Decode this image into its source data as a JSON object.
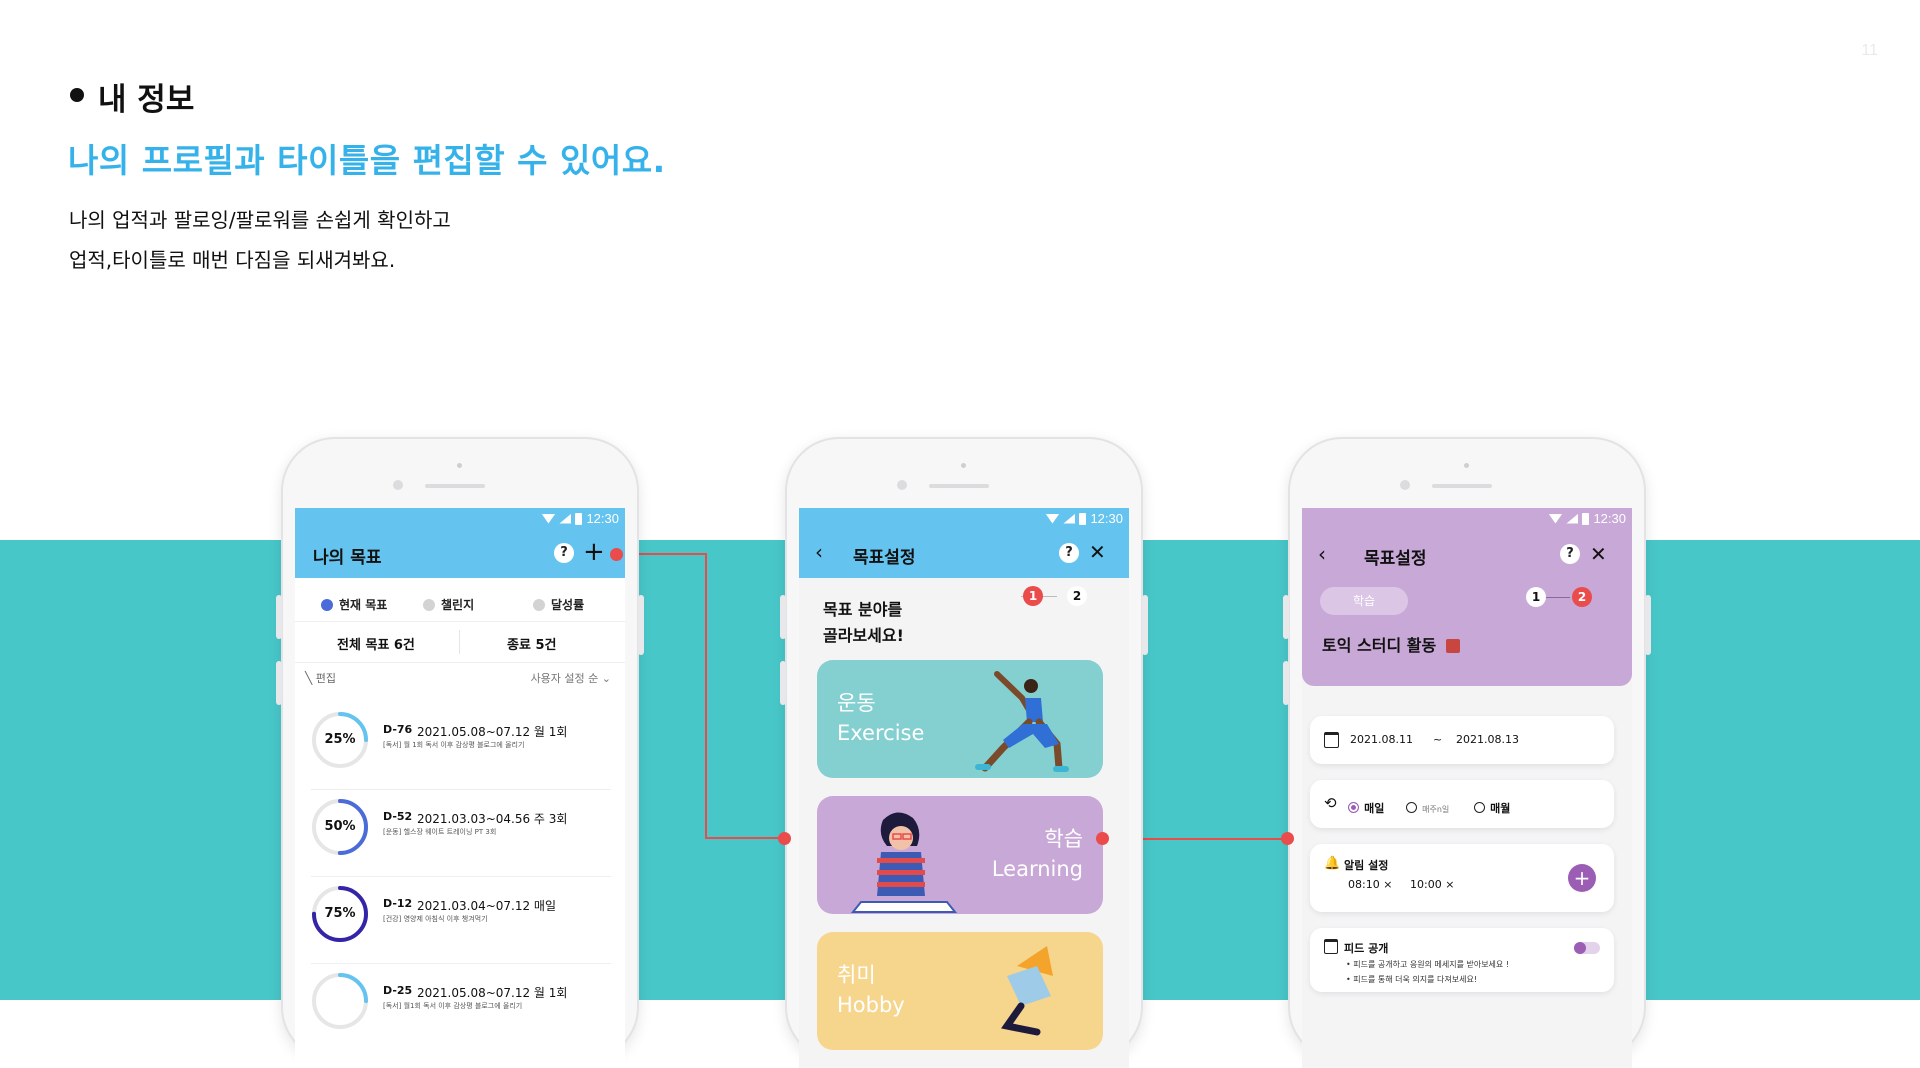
{
  "page": {
    "page_number": "11",
    "section_title": "내 정보",
    "headline": "나의 프로필과 타이틀을 편집할 수 있어요.",
    "desc_line1": "나의 업적과 팔로잉/팔로워를 손쉽게 확인하고",
    "desc_line2": "업적,타이틀로 매번 다짐을 되새겨봐요."
  },
  "colors": {
    "accent_blue": "#36b2ea",
    "band_teal": "#48c7c9",
    "appbar_blue": "#64c4ef",
    "purple": "#c8a8d6",
    "connector_red": "#ea4b4b"
  },
  "screen1": {
    "time": "12:30",
    "title": "나의 목표",
    "help": "?",
    "add_icon": "+",
    "tabs": [
      {
        "label": "현재 목표",
        "color": "#4a6bd8"
      },
      {
        "label": "챌린지",
        "color": "#d3d3d3"
      },
      {
        "label": "달성률",
        "color": "#d3d3d3"
      }
    ],
    "total_goals": "전체 목표 6건",
    "ended": "종료 5건",
    "edit_label": "편집",
    "sort_label": "사용자 설정 순",
    "goals": [
      {
        "percent": "25%",
        "progress": 0.25,
        "color": "#64c4ef",
        "dday": "D-76",
        "date": "2021.05.08~07.12 월 1회",
        "sub": "[독서] 월 1회 독서 이후 감상평 블로그에 올리기"
      },
      {
        "percent": "50%",
        "progress": 0.5,
        "color": "#4a6bd8",
        "dday": "D-52",
        "date": "2021.03.03~04.56 주 3회",
        "sub": "[운동] 헬스장 웨이트 트레이닝 PT 3회"
      },
      {
        "percent": "75%",
        "progress": 0.75,
        "color": "#3324a8",
        "dday": "D-12",
        "date": "2021.03.04~07.12 매일",
        "sub": "[건강] 영양제 아침식 이후 챙겨먹기"
      },
      {
        "percent": "",
        "progress": 0.25,
        "color": "#64c4ef",
        "dday": "D-25",
        "date": "2021.05.08~07.12 월 1회",
        "sub": "[독서] 월1회 독서 이후 감상평 블로그에 올리기"
      }
    ]
  },
  "screen2": {
    "time": "12:30",
    "title": "목표설정",
    "help": "?",
    "question_line1": "목표 분야를",
    "question_line2": "골라보세요!",
    "step1": "1",
    "step2": "2",
    "cards": [
      {
        "ko": "운동",
        "en": "Exercise",
        "bg": "#84cfcf"
      },
      {
        "ko": "학습",
        "en": "Learning",
        "bg": "#c8a8d6"
      },
      {
        "ko": "취미",
        "en": "Hobby",
        "bg": "#f6d58d"
      }
    ]
  },
  "screen3": {
    "time": "12:30",
    "title": "목표설정",
    "help": "?",
    "chip": "학습",
    "step1": "1",
    "step2": "2",
    "goal_name": "토익 스터디 활동",
    "date_start": "2021.08.11",
    "date_sep": "~",
    "date_end": "2021.08.13",
    "repeat_options": [
      "매일",
      "매주n일",
      "매월"
    ],
    "alarm_title": "알림 설정",
    "alarm_times": [
      "08:10",
      "10:00"
    ],
    "feed_title": "피드 공개",
    "feed_notes": [
      "피드를 공개하고 응원의 메세지를 받아보세요 !",
      "피드를 통해 더욱 의지를 다져보세요!"
    ]
  }
}
